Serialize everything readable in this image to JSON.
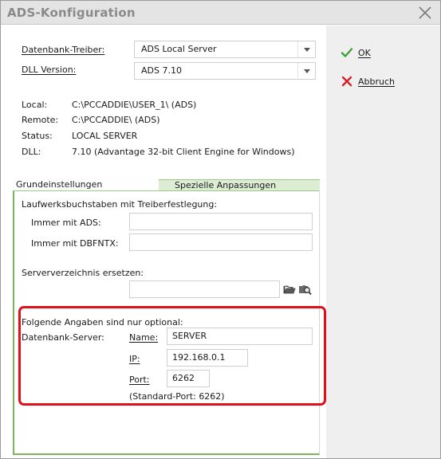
{
  "window": {
    "title": "ADS-Konfiguration"
  },
  "actions": {
    "ok_label": "OK",
    "cancel_label": "Abbruch",
    "ok_color": "#3ea034",
    "cancel_color": "#d6202a"
  },
  "driver": {
    "label": "Datenbank-Treiber:",
    "value": "ADS Local Server"
  },
  "dll_version": {
    "label": "DLL Version:",
    "value": "ADS 7.10"
  },
  "info": {
    "local_label": "Local:",
    "local_value": "C:\\PCCADDIE\\USER_1\\ (ADS)",
    "remote_label": "Remote:",
    "remote_value": "C:\\PCCADDIE\\ (ADS)",
    "status_label": "Status:",
    "status_value": "LOCAL SERVER",
    "dll_label": "DLL:",
    "dll_value": "7.10 (Advantage 32-bit Client Engine for Windows)"
  },
  "tabs": [
    {
      "label": "Grundeinstellungen"
    },
    {
      "label": "Spezielle Anpassungen"
    }
  ],
  "drive_letters": {
    "heading": "Laufwerksbuchstaben mit Treiberfestlegung:",
    "ads_label": "Immer mit ADS:",
    "ads_value": "",
    "dbfntx_label": "Immer mit DBFNTX:",
    "dbfntx_value": ""
  },
  "server_dir": {
    "heading": "Serververzeichnis ersetzen:",
    "value": ""
  },
  "optional": {
    "heading": "Folgende Angaben sind nur optional:",
    "db_server_label": "Datenbank-Server:",
    "name_label": "Name:",
    "name_value": "SERVER",
    "ip_label": "IP:",
    "ip_value": "192.168.0.1",
    "port_label": "Port:",
    "port_value": "6262",
    "port_note": "(Standard-Port: 6262)"
  }
}
